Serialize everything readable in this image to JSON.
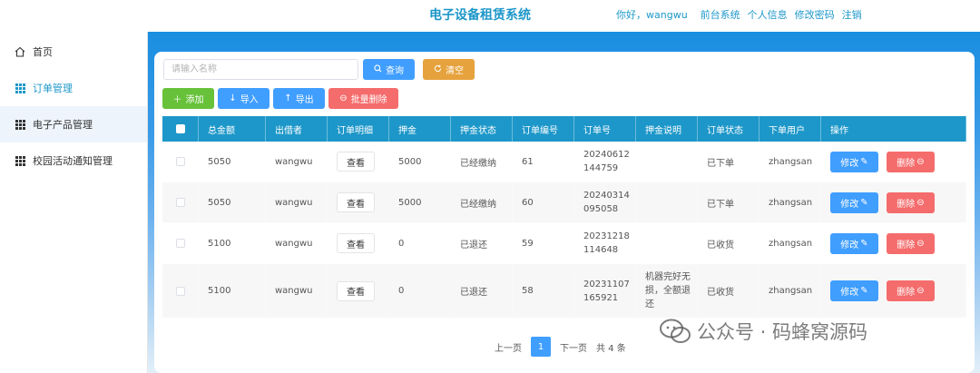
{
  "header": {
    "title": "电子设备租赁系统",
    "greeting": "你好，wangwu",
    "links": [
      "前台系统",
      "个人信息",
      "修改密码",
      "注销"
    ]
  },
  "sidebar": {
    "items": [
      {
        "label": "首页",
        "icon": "home-icon"
      },
      {
        "label": "订单管理",
        "icon": "grid-icon"
      },
      {
        "label": "电子产品管理",
        "icon": "grid-icon"
      },
      {
        "label": "校园活动通知管理",
        "icon": "grid-icon"
      }
    ]
  },
  "search": {
    "placeholder": "请输入名称",
    "query_label": "查询",
    "clear_label": "清空"
  },
  "toolbar": {
    "add_label": "添加",
    "import_label": "导入",
    "export_label": "导出",
    "batch_delete_label": "批量删除"
  },
  "table": {
    "columns": [
      "总金额",
      "出借者",
      "订单明细",
      "押金",
      "押金状态",
      "订单编号",
      "订单号",
      "押金说明",
      "订单状态",
      "下单用户",
      "操作"
    ],
    "rows": [
      {
        "total": "5050",
        "lender": "wangwu",
        "detail": "查看",
        "deposit": "5000",
        "deposit_status": "已经缴纳",
        "order_id": "61",
        "order_no": "20240612144759",
        "deposit_note": "",
        "order_status": "已下单",
        "user": "zhangsan"
      },
      {
        "total": "5050",
        "lender": "wangwu",
        "detail": "查看",
        "deposit": "5000",
        "deposit_status": "已经缴纳",
        "order_id": "60",
        "order_no": "20240314095058",
        "deposit_note": "",
        "order_status": "已下单",
        "user": "zhangsan"
      },
      {
        "total": "5100",
        "lender": "wangwu",
        "detail": "查看",
        "deposit": "0",
        "deposit_status": "已退还",
        "order_id": "59",
        "order_no": "20231218114648",
        "deposit_note": "",
        "order_status": "已收货",
        "user": "zhangsan"
      },
      {
        "total": "5100",
        "lender": "wangwu",
        "detail": "查看",
        "deposit": "0",
        "deposit_status": "已退还",
        "order_id": "58",
        "order_no": "20231107165921",
        "deposit_note": "机器完好无损，全额退还",
        "order_status": "已收货",
        "user": "zhangsan"
      }
    ],
    "edit_label": "修改",
    "delete_label": "删除"
  },
  "pager": {
    "prev": "上一页",
    "current": "1",
    "next": "下一页",
    "total": "共 4 条"
  },
  "watermark": {
    "text": "公众号 · 码蜂窝源码"
  }
}
